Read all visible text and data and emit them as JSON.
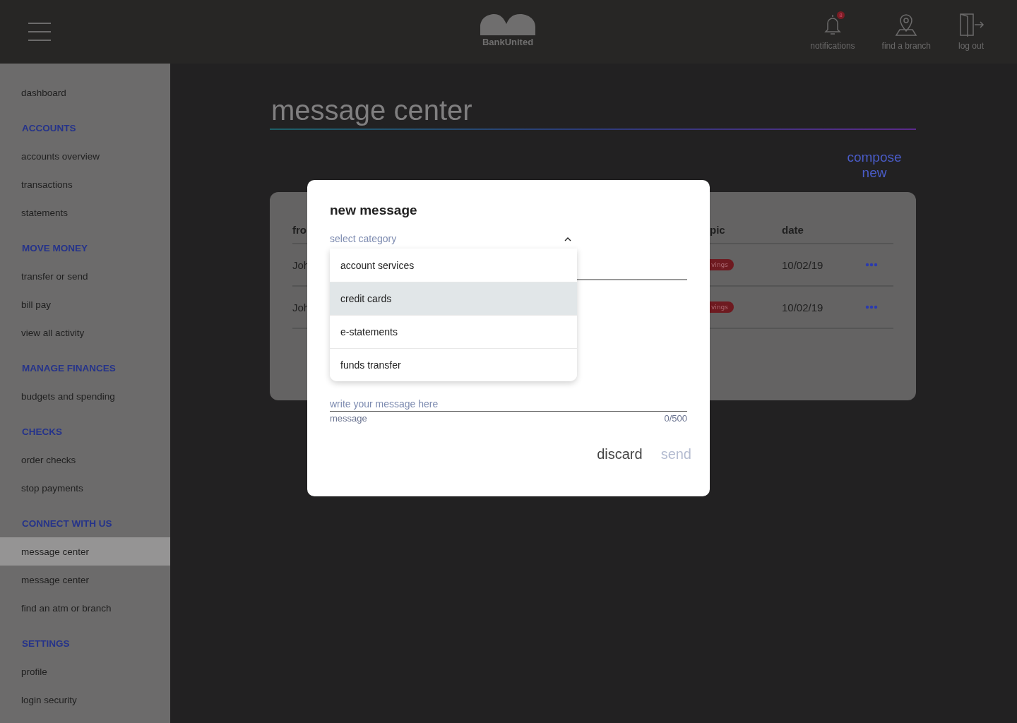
{
  "header": {
    "logo": "BankUnited",
    "actions": [
      {
        "kind": "bell",
        "label": "notifications",
        "badge": "8"
      },
      {
        "kind": "pin",
        "label": "find a branch"
      },
      {
        "kind": "door",
        "label": "log out"
      }
    ]
  },
  "sidebar": {
    "items": [
      {
        "kind": "link",
        "label": "dashboard",
        "selected": false
      },
      {
        "kind": "heading",
        "label": "ACCOUNTS"
      },
      {
        "kind": "link",
        "label": "accounts overview",
        "selected": false
      },
      {
        "kind": "link",
        "label": "transactions",
        "selected": false
      },
      {
        "kind": "link",
        "label": "statements",
        "selected": false
      },
      {
        "kind": "heading",
        "label": "MOVE MONEY"
      },
      {
        "kind": "link",
        "label": "transfer or send",
        "selected": false
      },
      {
        "kind": "link",
        "label": "bill pay",
        "selected": false
      },
      {
        "kind": "link",
        "label": "view all activity",
        "selected": false
      },
      {
        "kind": "heading",
        "label": "MANAGE FINANCES"
      },
      {
        "kind": "link",
        "label": "budgets and spending",
        "selected": false
      },
      {
        "kind": "heading",
        "label": "CHECKS"
      },
      {
        "kind": "link",
        "label": "order checks",
        "selected": false
      },
      {
        "kind": "link",
        "label": "stop payments",
        "selected": false
      },
      {
        "kind": "heading",
        "label": "CONNECT WITH US"
      },
      {
        "kind": "link",
        "label": "message center",
        "selected": true
      },
      {
        "kind": "link",
        "label": "message center",
        "selected": false
      },
      {
        "kind": "link",
        "label": "find an atm or branch",
        "selected": false
      },
      {
        "kind": "heading",
        "label": "SETTINGS"
      },
      {
        "kind": "link",
        "label": "profile",
        "selected": false
      },
      {
        "kind": "link",
        "label": "login security",
        "selected": false
      }
    ]
  },
  "page": {
    "title": "message center",
    "compose": "compose new"
  },
  "table": {
    "columns": [
      "fro",
      "pic",
      "date"
    ],
    "rows": [
      {
        "from": "Joh",
        "tag": "vings",
        "date": "10/02/19"
      },
      {
        "from": "Joh",
        "tag": "vings",
        "date": "10/02/19"
      }
    ]
  },
  "dialog": {
    "title": "new message",
    "category": {
      "placeholder": "select category",
      "expanded": true,
      "options": [
        {
          "label": "account services",
          "selected": false
        },
        {
          "label": "credit cards",
          "selected": true
        },
        {
          "label": "e-statements",
          "selected": false
        },
        {
          "label": "funds transfer",
          "selected": false
        }
      ]
    },
    "message": {
      "placeholder": "write your message here",
      "helper": "message",
      "counter": "0/500"
    },
    "buttons": [
      {
        "label": "discard",
        "disabled": false
      },
      {
        "label": "send",
        "disabled": true
      }
    ]
  }
}
